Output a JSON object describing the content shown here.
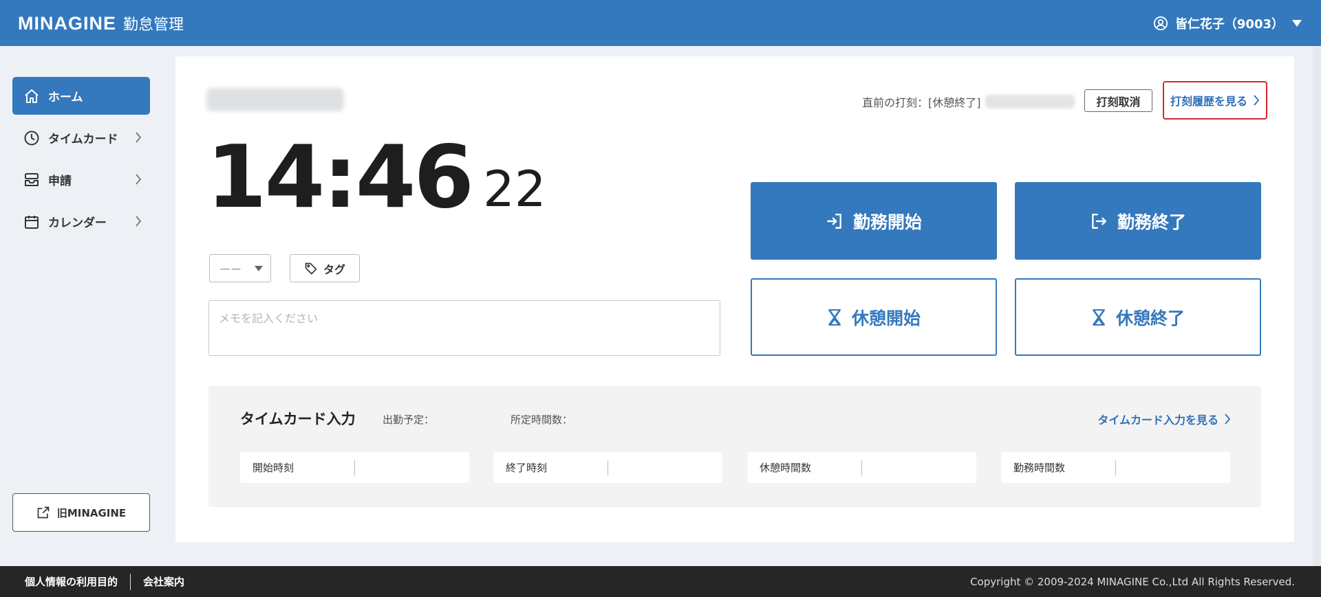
{
  "header": {
    "logo": "MINAGINE",
    "subtitle": "勤怠管理",
    "user_name": "皆仁花子（9003）"
  },
  "sidebar": {
    "items": [
      {
        "label": "ホーム",
        "icon": "home-icon",
        "active": true
      },
      {
        "label": "タイムカード",
        "icon": "clock-icon"
      },
      {
        "label": "申請",
        "icon": "inbox-icon"
      },
      {
        "label": "カレンダー",
        "icon": "calendar-icon"
      }
    ],
    "old_button": "旧MINAGINE"
  },
  "main": {
    "last_punch_label": "直前の打刻：[休憩終了]",
    "cancel_button": "打刻取消",
    "history_button": "打刻履歴を見る",
    "clock": {
      "hours_minutes": "14:46",
      "seconds": "22"
    },
    "select_value": "ーー",
    "tag_button": "タグ",
    "memo_placeholder": "メモを記入ください",
    "buttons": {
      "work_start": "勤務開始",
      "work_end": "勤務終了",
      "break_start": "休憩開始",
      "break_end": "休憩終了"
    },
    "timecard": {
      "title": "タイムカード入力",
      "scheduled_label": "出勤予定：",
      "prescribed_label": "所定時間数：",
      "link": "タイムカード入力を見る",
      "fields": [
        "開始時刻",
        "終了時刻",
        "休憩時間数",
        "勤務時間数"
      ]
    }
  },
  "footer": {
    "privacy": "個人情報の利用目的",
    "company": "会社案内",
    "copyright": "Copyright © 2009-2024 MINAGINE Co.,Ltd All Rights Reserved."
  },
  "colors": {
    "primary": "#3478bd",
    "highlight": "#d8262f",
    "footer": "#262626"
  }
}
